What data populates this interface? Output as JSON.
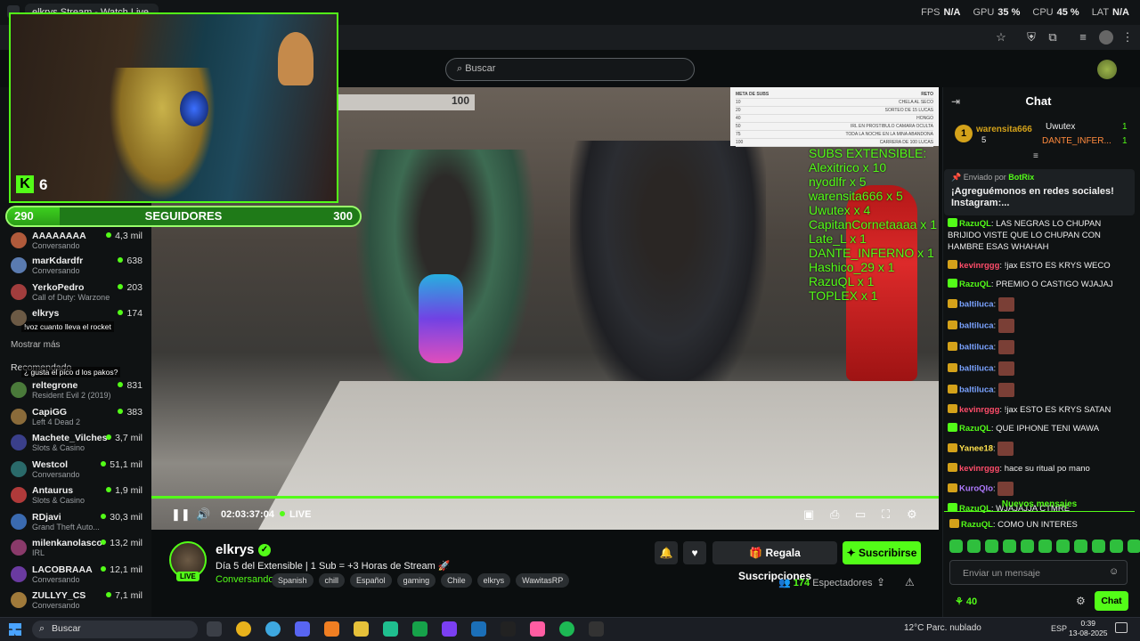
{
  "browser": {
    "tab_title": "elkrys Stream - Watch Live...",
    "perf": {
      "fps_label": "FPS",
      "fps": "N/A",
      "gpu_label": "GPU",
      "gpu": "35 %",
      "cpu_label": "CPU",
      "cpu": "45 %",
      "lat_label": "LAT",
      "lat": "N/A"
    }
  },
  "header": {
    "search_placeholder": "Buscar"
  },
  "overlay": {
    "kick_logo": "K",
    "viewer_count": "6",
    "followers": {
      "label": "SEGUIDORES",
      "start": "290",
      "end": "300",
      "progress_fraction": 0.15
    }
  },
  "sidebar": {
    "channels_top": [
      {
        "name": "AAAAAAAA",
        "game": "Conversando",
        "viewers": "4,3 mil",
        "color": "#b05a3b"
      },
      {
        "name": "marKdardfr",
        "game": "Conversando",
        "viewers": "638",
        "color": "#5a7bb0"
      },
      {
        "name": "YerkoPedro",
        "game": "Call of Duty: Warzone",
        "viewers": "203",
        "color": "#a13d3d"
      },
      {
        "name": "elkrys",
        "game": "",
        "viewers": "174",
        "color": "#6c5a45"
      }
    ],
    "overlay_chat_1": "!voz cuanto lleva el rocket",
    "overlay_chat_2": "¿ gusta el pico d los pakos?",
    "show_more": "Mostrar más",
    "recommended_title": "Recomendado",
    "recommended": [
      {
        "name": "reltegrone",
        "game": "Resident Evil 2 (2019)",
        "viewers": "831",
        "color": "#4a7a3a"
      },
      {
        "name": "CapiGG",
        "game": "Left 4 Dead 2",
        "viewers": "383",
        "color": "#8a6b3a"
      },
      {
        "name": "Machete_Vilches",
        "game": "Slots & Casino",
        "viewers": "3,7 mil",
        "color": "#3a3f8a"
      },
      {
        "name": "Westcol",
        "game": "Conversando",
        "viewers": "51,1 mil",
        "color": "#2a6a6a"
      },
      {
        "name": "Antaurus",
        "game": "Slots & Casino",
        "viewers": "1,9 mil",
        "color": "#b03a3a"
      },
      {
        "name": "RDjavi",
        "game": "Grand Theft Auto...",
        "viewers": "30,3 mil",
        "color": "#3a6ab0"
      },
      {
        "name": "milenkanolasco",
        "game": "IRL",
        "viewers": "13,2 mil",
        "color": "#8a3a6a"
      },
      {
        "name": "LACOBRAAA",
        "game": "Conversando",
        "viewers": "12,1 mil",
        "color": "#6a3aa0"
      },
      {
        "name": "ZULLYY_CS",
        "game": "Conversando",
        "viewers": "7,1 mil",
        "color": "#a07a3a"
      }
    ]
  },
  "video": {
    "sign": "100",
    "subs_sheet_header": [
      "META DE SUBS",
      "RETO"
    ],
    "subs_sheet_rows": [
      [
        "10",
        "CHELA AL SECO"
      ],
      [
        "20",
        "SORTEO DE 15 LUCAS"
      ],
      [
        "40",
        "HONGO"
      ],
      [
        "50",
        "IRL EN PROSTIBULO CAMARA OCULTA"
      ],
      [
        "75",
        "TODA LA NOCHE EN LA MINA ABANDONA"
      ],
      [
        "100",
        "CARRERA DE 100 LUCAS"
      ]
    ],
    "subs_title": "SUBS EXTENSIBLE:",
    "subs_list": [
      "Alexitrico x 10",
      "nyodlfr x 5",
      "warensita666 x 5",
      "Uwutex x 4",
      "CapitanCornetaaaa x 1",
      "Late_L x 1",
      "DANTE_INFERNO x 1",
      "Hashico_29 x 1",
      "RazuQL x 1",
      "TOPLEX x 1"
    ],
    "time": "02:03:37:04",
    "live_label": "LIVE"
  },
  "stream": {
    "live_badge": "LIVE",
    "name": "elkrys",
    "title": "Día 5 del Extensible | 1 Sub = +3 Horas de Stream 🚀",
    "category": "Conversando",
    "tags": [
      "Spanish",
      "chill",
      "Español",
      "gaming",
      "Chile",
      "elkrys",
      "WawitasRP"
    ],
    "gift_label": "Regala Suscripciones",
    "subscribe_label": "Suscribirse",
    "viewers": "174",
    "viewers_label": "Espectadores"
  },
  "chat": {
    "title": "Chat",
    "leaders": [
      {
        "rank": "1",
        "name": "warensita666",
        "count": "5"
      },
      {
        "name": "Uwutex",
        "count": "1"
      },
      {
        "name": "DANTE_INFER...",
        "count": "1"
      }
    ],
    "pinned_by": "Enviado por",
    "pinned_user": "BotRix",
    "pinned_msg": "¡Agreguémonos en redes sociales! Instagram:...",
    "messages": [
      {
        "user": "RazuQL",
        "color": "#53fc18",
        "text": "LAS NEGRAS LO CHUPAN BRIJIDO VISTE QUE LO CHUPAN CON HAMBRE ESAS WHAHAH"
      },
      {
        "user": "kevinrggg",
        "color": "#ff4d6a",
        "text": "!jax ESTO ES KRYS WECO"
      },
      {
        "user": "RazuQL",
        "color": "#53fc18",
        "text": "PREMIO O CASTIGO WJAJAJ"
      },
      {
        "user": "baltiluca",
        "color": "#7aa2ff",
        "text": ""
      },
      {
        "user": "baltiluca",
        "color": "#7aa2ff",
        "text": ""
      },
      {
        "user": "baltiluca",
        "color": "#7aa2ff",
        "text": ""
      },
      {
        "user": "baltiluca",
        "color": "#7aa2ff",
        "text": ""
      },
      {
        "user": "baltiluca",
        "color": "#7aa2ff",
        "text": ""
      },
      {
        "user": "kevinrggg",
        "color": "#ff4d6a",
        "text": "!jax ESTO ES KRYS SATAN"
      },
      {
        "user": "RazuQL",
        "color": "#53fc18",
        "text": "QUE IPHONE TENI WAWA"
      },
      {
        "user": "Yanee18",
        "color": "#ffe14d",
        "text": ""
      },
      {
        "user": "kevinrggg",
        "color": "#ff4d6a",
        "text": "hace su ritual po mano"
      },
      {
        "user": "KuroQlo",
        "color": "#b07aff",
        "text": ""
      },
      {
        "user": "RazuQL",
        "color": "#53fc18",
        "text": "WJAJAJJA CTMRE"
      },
      {
        "user": "RazuQL",
        "color": "#53fc18",
        "text": "COMO UN INTERES"
      }
    ],
    "new_messages": "Nuevos mensajes",
    "input_placeholder": "Enviar un mensaje",
    "kicks": "40",
    "send_label": "Chat"
  },
  "taskbar": {
    "search_placeholder": "Buscar",
    "weather": "12°C  Parc. nublado",
    "lang": "ESP",
    "time": "0:39",
    "date": "13-08-2025"
  }
}
